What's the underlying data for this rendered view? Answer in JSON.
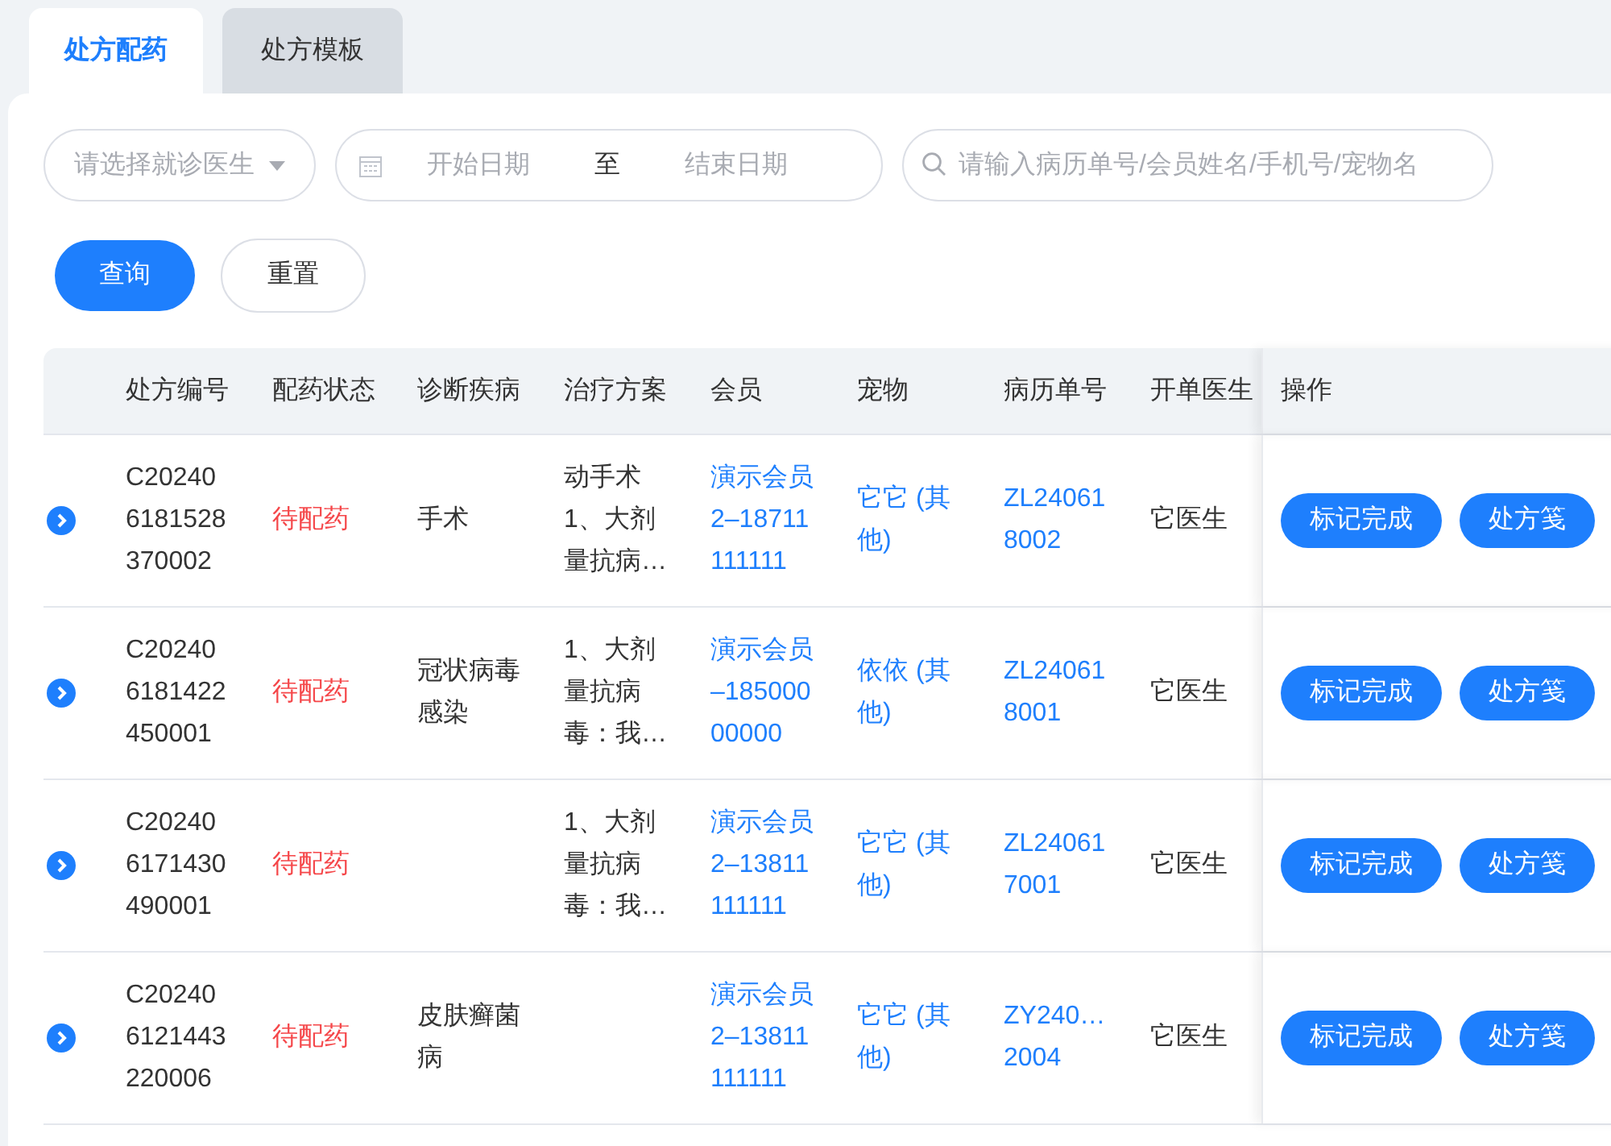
{
  "tabs": [
    {
      "label": "处方配药",
      "selected": true
    },
    {
      "label": "处方模板",
      "selected": false
    }
  ],
  "filters": {
    "doctor_select": {
      "placeholder": "请选择就诊医生"
    },
    "date_range": {
      "start_placeholder": "开始日期",
      "separator": "至",
      "end_placeholder": "结束日期"
    },
    "search": {
      "placeholder": "请输入病历单号/会员姓名/手机号/宠物名"
    }
  },
  "buttons": [
    {
      "label": "查询",
      "kind": "primary"
    },
    {
      "label": "重置",
      "kind": "default"
    }
  ],
  "table": {
    "columns": [
      "处方编号",
      "配药状态",
      "诊断疾病",
      "治疗方案",
      "会员",
      "宠物",
      "病历单号",
      "开单医生",
      "操作"
    ],
    "rows": [
      {
        "code": [
          "C20240",
          "6181528",
          "370002"
        ],
        "status": "待配药",
        "diagnosis": [
          "手术"
        ],
        "plan": [
          "动手术",
          "1、大剂",
          "量抗病…"
        ],
        "member": [
          "演示会员",
          "2–18711",
          "111111"
        ],
        "pet": [
          "它它 (其",
          "他)"
        ],
        "record": [
          "ZL24061",
          "8002"
        ],
        "doctor": "它医生",
        "actions": [
          "标记完成",
          "处方笺"
        ]
      },
      {
        "code": [
          "C20240",
          "6181422",
          "450001"
        ],
        "status": "待配药",
        "diagnosis": [
          "冠状病毒",
          "感染"
        ],
        "plan": [
          "1、大剂",
          "量抗病",
          "毒：我…"
        ],
        "member": [
          "演示会员",
          "–185000",
          "00000"
        ],
        "pet": [
          "依依 (其",
          "他)"
        ],
        "record": [
          "ZL24061",
          "8001"
        ],
        "doctor": "它医生",
        "actions": [
          "标记完成",
          "处方笺"
        ]
      },
      {
        "code": [
          "C20240",
          "6171430",
          "490001"
        ],
        "status": "待配药",
        "diagnosis": [],
        "plan": [
          "1、大剂",
          "量抗病",
          "毒：我…"
        ],
        "member": [
          "演示会员",
          "2–13811",
          "111111"
        ],
        "pet": [
          "它它 (其",
          "他)"
        ],
        "record": [
          "ZL24061",
          "7001"
        ],
        "doctor": "它医生",
        "actions": [
          "标记完成",
          "处方笺"
        ]
      },
      {
        "code": [
          "C20240",
          "6121443",
          "220006"
        ],
        "status": "待配药",
        "diagnosis": [
          "皮肤癣菌",
          "病"
        ],
        "plan": [],
        "member": [
          "演示会员",
          "2–13811",
          "111111"
        ],
        "pet": [
          "它它 (其",
          "他)"
        ],
        "record": [
          "ZY240…",
          "2004"
        ],
        "doctor": "它医生",
        "actions": [
          "标记完成",
          "处方笺"
        ]
      }
    ]
  }
}
